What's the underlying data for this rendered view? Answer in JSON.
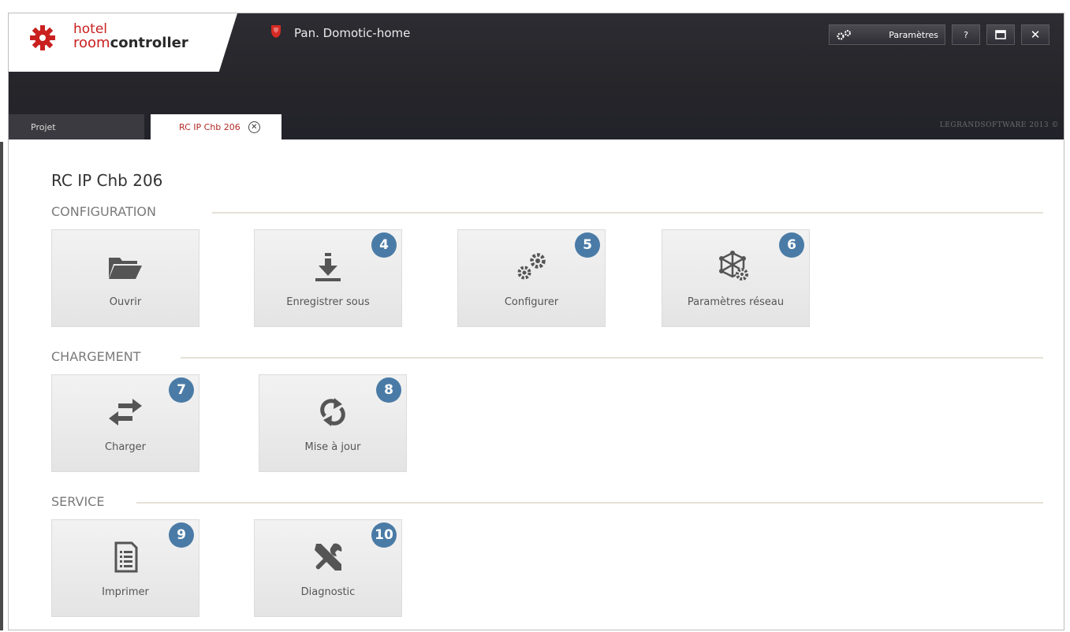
{
  "app": {
    "logo_line1": "hotel",
    "logo_line2a": "room",
    "logo_line2b": "controller",
    "project_title": "Pan. Domotic-home",
    "copyright": "LEGRANDSOFTWARE 2013 ©"
  },
  "toolbar": {
    "params_label": "Paramètres",
    "help_label": "?",
    "close_label": "✕"
  },
  "tabs": [
    {
      "label": "Projet"
    },
    {
      "label": "RC IP Chb 206"
    }
  ],
  "page": {
    "title": "RC IP Chb 206"
  },
  "sections": {
    "configuration": {
      "title": "CONFIGURATION",
      "tiles": [
        {
          "label": "Ouvrir",
          "icon": "folder-icon"
        },
        {
          "label": "Enregistrer sous",
          "icon": "download-icon",
          "badge": "4"
        },
        {
          "label": "Configurer",
          "icon": "gears-icon",
          "badge": "5"
        },
        {
          "label": "Paramètres réseau",
          "icon": "network-settings-icon",
          "badge": "6"
        }
      ]
    },
    "chargement": {
      "title": "CHARGEMENT",
      "tiles": [
        {
          "label": "Charger",
          "icon": "transfer-arrows-icon",
          "badge": "7"
        },
        {
          "label": "Mise à jour",
          "icon": "refresh-icon",
          "badge": "8"
        }
      ]
    },
    "service": {
      "title": "SERVICE",
      "tiles": [
        {
          "label": "Imprimer",
          "icon": "document-icon",
          "badge": "9"
        },
        {
          "label": "Diagnostic",
          "icon": "tools-icon",
          "badge": "10"
        }
      ]
    }
  },
  "colors": {
    "header_bg": "#25252a",
    "brand_red": "#c9201f",
    "badge_blue": "#4a7ba6",
    "tile_bg": "#ebebeb"
  }
}
